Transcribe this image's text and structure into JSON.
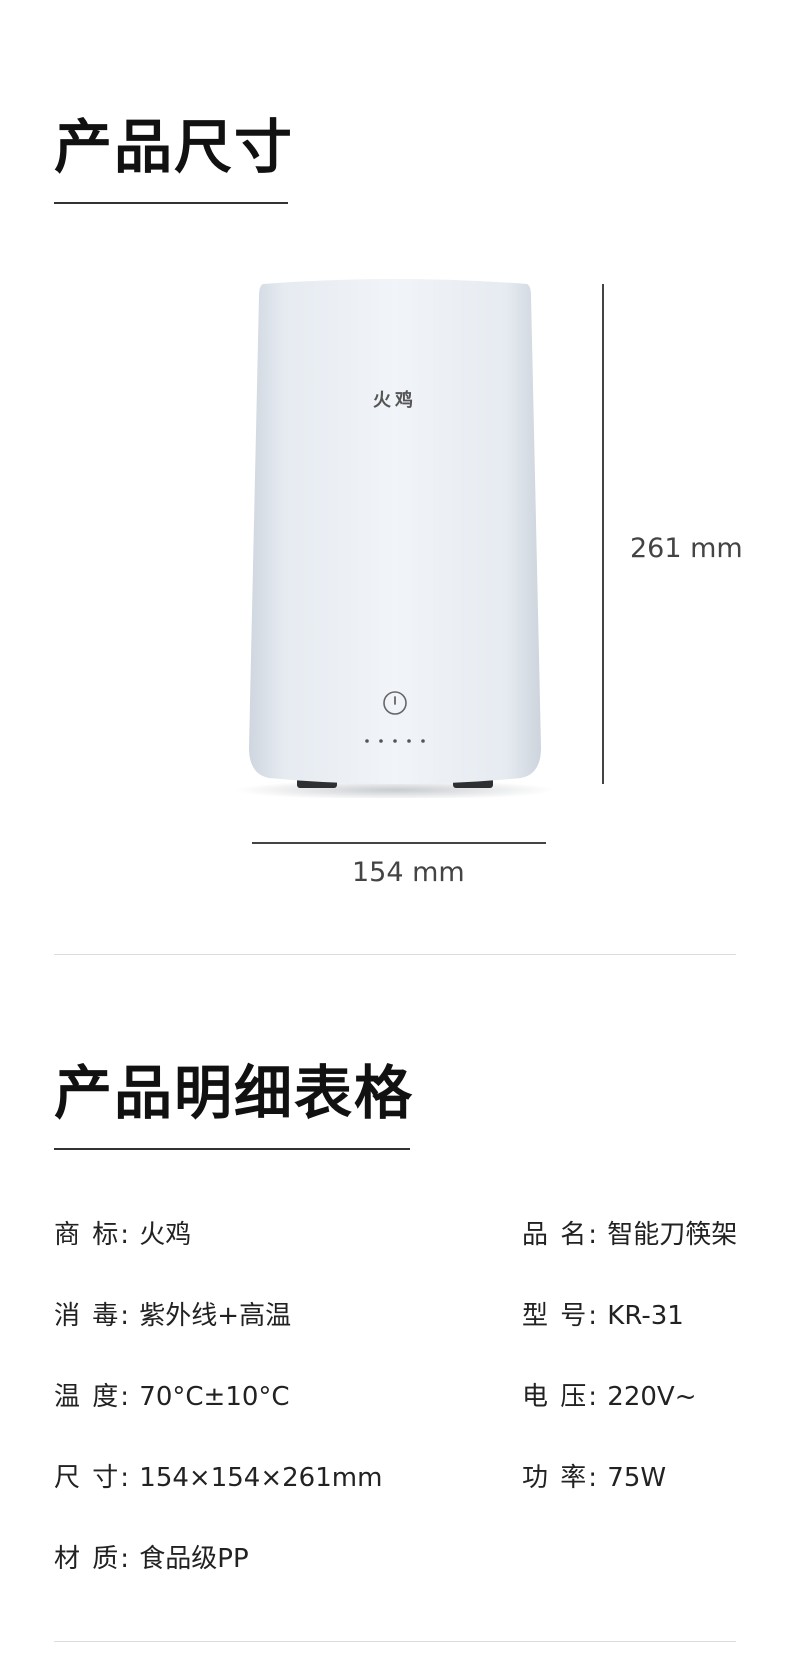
{
  "size_section": {
    "title": "产品尺寸",
    "product": {
      "brand_mark": "火鸡",
      "height_label": "261 mm",
      "width_label": "154 mm"
    }
  },
  "detail_section": {
    "title": "产品明细表格",
    "specs_left": [
      {
        "label": "商 标:",
        "value": "火鸡"
      },
      {
        "label": "消 毒:",
        "value": "紫外线+高温"
      },
      {
        "label": "温 度:",
        "value": "70°C±10°C"
      },
      {
        "label": "尺 寸:",
        "value": "154×154×261mm"
      },
      {
        "label": "材 质:",
        "value": "食品级PP"
      }
    ],
    "specs_right": [
      {
        "label": "品 名:",
        "value": "智能刀筷架"
      },
      {
        "label": "型 号:",
        "value": "KR-31"
      },
      {
        "label": "电 压:",
        "value": "220V~"
      },
      {
        "label": "功 率:",
        "value": "75W"
      }
    ]
  }
}
